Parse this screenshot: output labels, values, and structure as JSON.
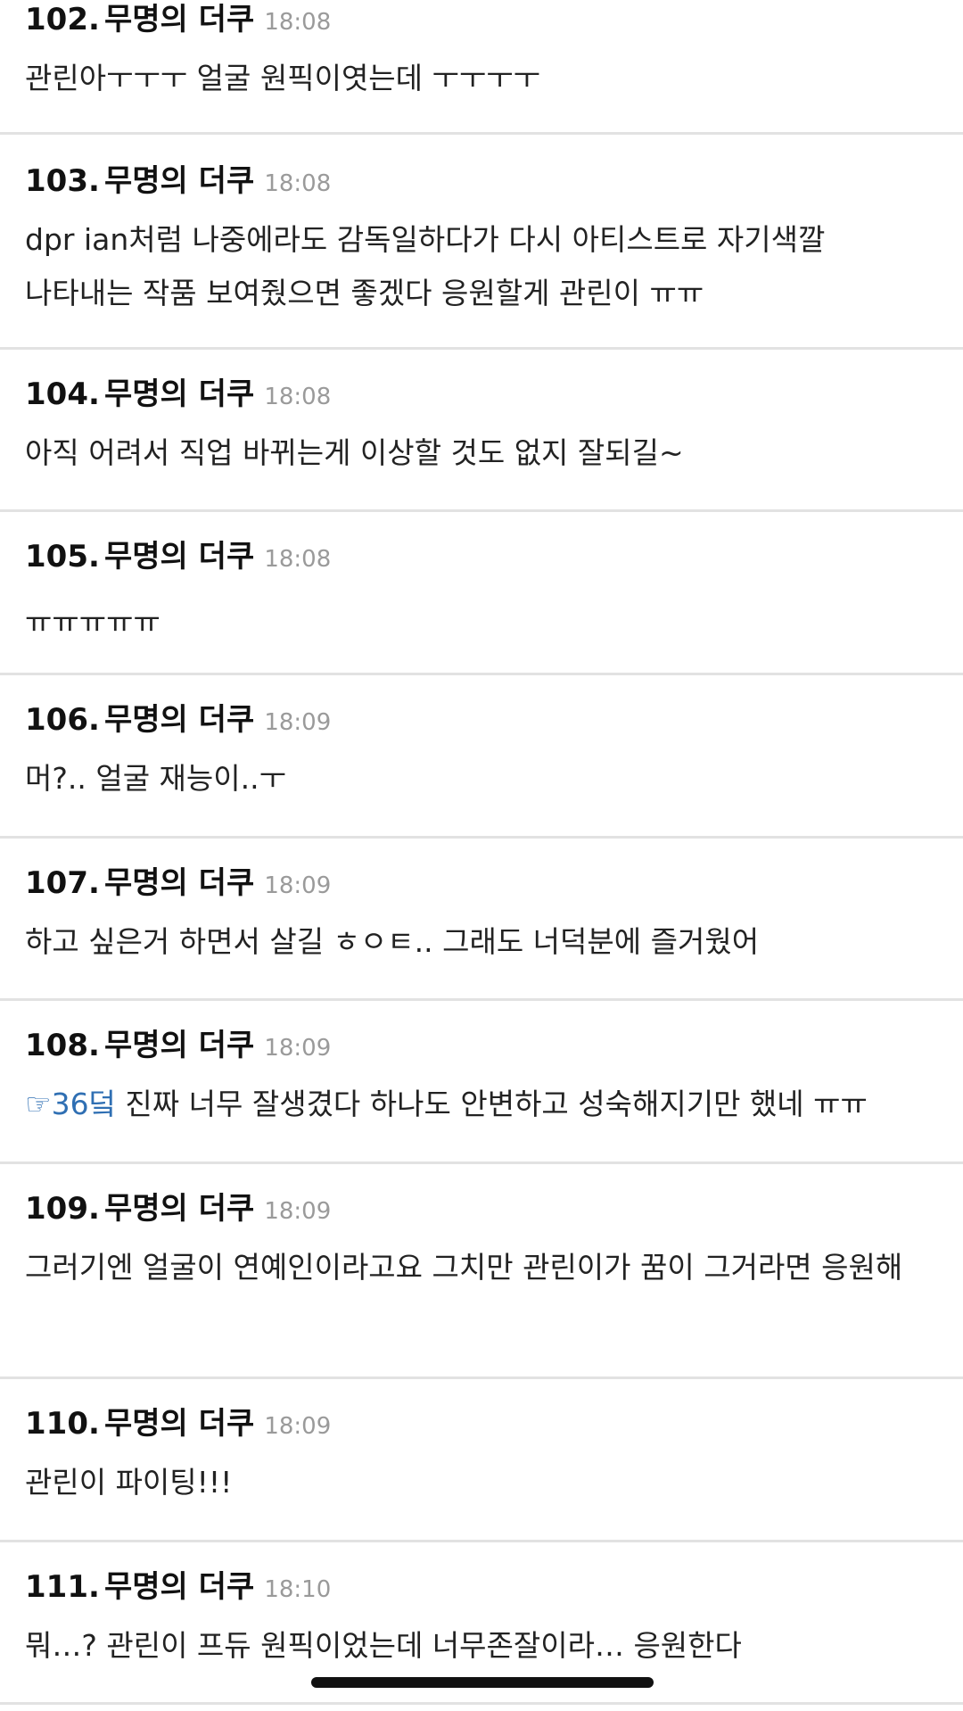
{
  "comments": [
    {
      "number": "102.",
      "author": "무명의 더쿠",
      "time": "18:08",
      "text": "관린아ㅜㅜㅜ 얼굴 원픽이엿는데 ㅜㅜㅜㅜ"
    },
    {
      "number": "103.",
      "author": "무명의 더쿠",
      "time": "18:08",
      "text": "dpr ian처럼 나중에라도 감독일하다가 다시 아티스트로 자기색깔 나타내는 작품 보여줬으면 좋겠다 응원할게 관린이 ㅠㅠ"
    },
    {
      "number": "104.",
      "author": "무명의 더쿠",
      "time": "18:08",
      "text": "아직 어려서 직업 바뀌는게 이상할 것도 없지 잘되길~"
    },
    {
      "number": "105.",
      "author": "무명의 더쿠",
      "time": "18:08",
      "text": "ㅠㅠㅠㅠㅠ"
    },
    {
      "number": "106.",
      "author": "무명의 더쿠",
      "time": "18:09",
      "text": "머?.. 얼굴 재능이..ㅜ"
    },
    {
      "number": "107.",
      "author": "무명의 더쿠",
      "time": "18:09",
      "text": "하고 싶은거 하면서 살길 ㅎㅇㅌ.. 그래도 너덕분에 즐거웠어"
    },
    {
      "number": "108.",
      "author": "무명의 더쿠",
      "time": "18:09",
      "anchor": "☞36덬",
      "text": " 진짜 너무 잘생겼다 하나도 안변하고 성숙해지기만 했네 ㅠㅠ"
    },
    {
      "number": "109.",
      "author": "무명의 더쿠",
      "time": "18:09",
      "text": "그러기엔 얼굴이 연예인이라고요 그치만 관린이가 꿈이 그거라면 응원해"
    },
    {
      "number": "110.",
      "author": "무명의 더쿠",
      "time": "18:09",
      "text": "관린이 파이팅!!!"
    },
    {
      "number": "111.",
      "author": "무명의 더쿠",
      "time": "18:10",
      "text": "뭐…? 관린이 프듀 원픽이었는데 너무존잘이라… 응원한다"
    }
  ],
  "colors": {
    "link": "#2f6fb3",
    "time": "#9a9a9a",
    "divider": "#e2e2e2"
  }
}
